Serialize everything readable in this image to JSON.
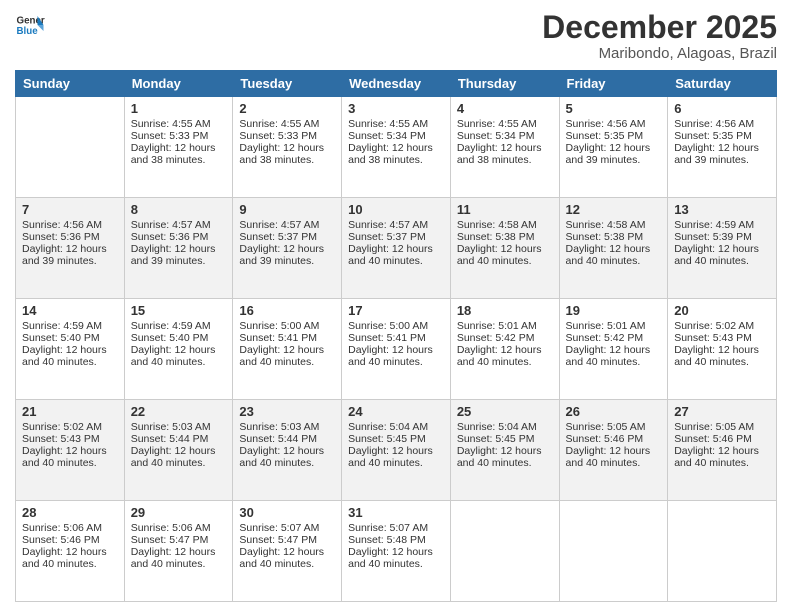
{
  "header": {
    "logo_line1": "General",
    "logo_line2": "Blue",
    "month_title": "December 2025",
    "subtitle": "Maribondo, Alagoas, Brazil"
  },
  "days_of_week": [
    "Sunday",
    "Monday",
    "Tuesday",
    "Wednesday",
    "Thursday",
    "Friday",
    "Saturday"
  ],
  "weeks": [
    [
      {
        "num": "",
        "sunrise": "",
        "sunset": "",
        "daylight": ""
      },
      {
        "num": "1",
        "sunrise": "Sunrise: 4:55 AM",
        "sunset": "Sunset: 5:33 PM",
        "daylight": "Daylight: 12 hours and 38 minutes."
      },
      {
        "num": "2",
        "sunrise": "Sunrise: 4:55 AM",
        "sunset": "Sunset: 5:33 PM",
        "daylight": "Daylight: 12 hours and 38 minutes."
      },
      {
        "num": "3",
        "sunrise": "Sunrise: 4:55 AM",
        "sunset": "Sunset: 5:34 PM",
        "daylight": "Daylight: 12 hours and 38 minutes."
      },
      {
        "num": "4",
        "sunrise": "Sunrise: 4:55 AM",
        "sunset": "Sunset: 5:34 PM",
        "daylight": "Daylight: 12 hours and 38 minutes."
      },
      {
        "num": "5",
        "sunrise": "Sunrise: 4:56 AM",
        "sunset": "Sunset: 5:35 PM",
        "daylight": "Daylight: 12 hours and 39 minutes."
      },
      {
        "num": "6",
        "sunrise": "Sunrise: 4:56 AM",
        "sunset": "Sunset: 5:35 PM",
        "daylight": "Daylight: 12 hours and 39 minutes."
      }
    ],
    [
      {
        "num": "7",
        "sunrise": "Sunrise: 4:56 AM",
        "sunset": "Sunset: 5:36 PM",
        "daylight": "Daylight: 12 hours and 39 minutes."
      },
      {
        "num": "8",
        "sunrise": "Sunrise: 4:57 AM",
        "sunset": "Sunset: 5:36 PM",
        "daylight": "Daylight: 12 hours and 39 minutes."
      },
      {
        "num": "9",
        "sunrise": "Sunrise: 4:57 AM",
        "sunset": "Sunset: 5:37 PM",
        "daylight": "Daylight: 12 hours and 39 minutes."
      },
      {
        "num": "10",
        "sunrise": "Sunrise: 4:57 AM",
        "sunset": "Sunset: 5:37 PM",
        "daylight": "Daylight: 12 hours and 40 minutes."
      },
      {
        "num": "11",
        "sunrise": "Sunrise: 4:58 AM",
        "sunset": "Sunset: 5:38 PM",
        "daylight": "Daylight: 12 hours and 40 minutes."
      },
      {
        "num": "12",
        "sunrise": "Sunrise: 4:58 AM",
        "sunset": "Sunset: 5:38 PM",
        "daylight": "Daylight: 12 hours and 40 minutes."
      },
      {
        "num": "13",
        "sunrise": "Sunrise: 4:59 AM",
        "sunset": "Sunset: 5:39 PM",
        "daylight": "Daylight: 12 hours and 40 minutes."
      }
    ],
    [
      {
        "num": "14",
        "sunrise": "Sunrise: 4:59 AM",
        "sunset": "Sunset: 5:40 PM",
        "daylight": "Daylight: 12 hours and 40 minutes."
      },
      {
        "num": "15",
        "sunrise": "Sunrise: 4:59 AM",
        "sunset": "Sunset: 5:40 PM",
        "daylight": "Daylight: 12 hours and 40 minutes."
      },
      {
        "num": "16",
        "sunrise": "Sunrise: 5:00 AM",
        "sunset": "Sunset: 5:41 PM",
        "daylight": "Daylight: 12 hours and 40 minutes."
      },
      {
        "num": "17",
        "sunrise": "Sunrise: 5:00 AM",
        "sunset": "Sunset: 5:41 PM",
        "daylight": "Daylight: 12 hours and 40 minutes."
      },
      {
        "num": "18",
        "sunrise": "Sunrise: 5:01 AM",
        "sunset": "Sunset: 5:42 PM",
        "daylight": "Daylight: 12 hours and 40 minutes."
      },
      {
        "num": "19",
        "sunrise": "Sunrise: 5:01 AM",
        "sunset": "Sunset: 5:42 PM",
        "daylight": "Daylight: 12 hours and 40 minutes."
      },
      {
        "num": "20",
        "sunrise": "Sunrise: 5:02 AM",
        "sunset": "Sunset: 5:43 PM",
        "daylight": "Daylight: 12 hours and 40 minutes."
      }
    ],
    [
      {
        "num": "21",
        "sunrise": "Sunrise: 5:02 AM",
        "sunset": "Sunset: 5:43 PM",
        "daylight": "Daylight: 12 hours and 40 minutes."
      },
      {
        "num": "22",
        "sunrise": "Sunrise: 5:03 AM",
        "sunset": "Sunset: 5:44 PM",
        "daylight": "Daylight: 12 hours and 40 minutes."
      },
      {
        "num": "23",
        "sunrise": "Sunrise: 5:03 AM",
        "sunset": "Sunset: 5:44 PM",
        "daylight": "Daylight: 12 hours and 40 minutes."
      },
      {
        "num": "24",
        "sunrise": "Sunrise: 5:04 AM",
        "sunset": "Sunset: 5:45 PM",
        "daylight": "Daylight: 12 hours and 40 minutes."
      },
      {
        "num": "25",
        "sunrise": "Sunrise: 5:04 AM",
        "sunset": "Sunset: 5:45 PM",
        "daylight": "Daylight: 12 hours and 40 minutes."
      },
      {
        "num": "26",
        "sunrise": "Sunrise: 5:05 AM",
        "sunset": "Sunset: 5:46 PM",
        "daylight": "Daylight: 12 hours and 40 minutes."
      },
      {
        "num": "27",
        "sunrise": "Sunrise: 5:05 AM",
        "sunset": "Sunset: 5:46 PM",
        "daylight": "Daylight: 12 hours and 40 minutes."
      }
    ],
    [
      {
        "num": "28",
        "sunrise": "Sunrise: 5:06 AM",
        "sunset": "Sunset: 5:46 PM",
        "daylight": "Daylight: 12 hours and 40 minutes."
      },
      {
        "num": "29",
        "sunrise": "Sunrise: 5:06 AM",
        "sunset": "Sunset: 5:47 PM",
        "daylight": "Daylight: 12 hours and 40 minutes."
      },
      {
        "num": "30",
        "sunrise": "Sunrise: 5:07 AM",
        "sunset": "Sunset: 5:47 PM",
        "daylight": "Daylight: 12 hours and 40 minutes."
      },
      {
        "num": "31",
        "sunrise": "Sunrise: 5:07 AM",
        "sunset": "Sunset: 5:48 PM",
        "daylight": "Daylight: 12 hours and 40 minutes."
      },
      {
        "num": "",
        "sunrise": "",
        "sunset": "",
        "daylight": ""
      },
      {
        "num": "",
        "sunrise": "",
        "sunset": "",
        "daylight": ""
      },
      {
        "num": "",
        "sunrise": "",
        "sunset": "",
        "daylight": ""
      }
    ]
  ]
}
